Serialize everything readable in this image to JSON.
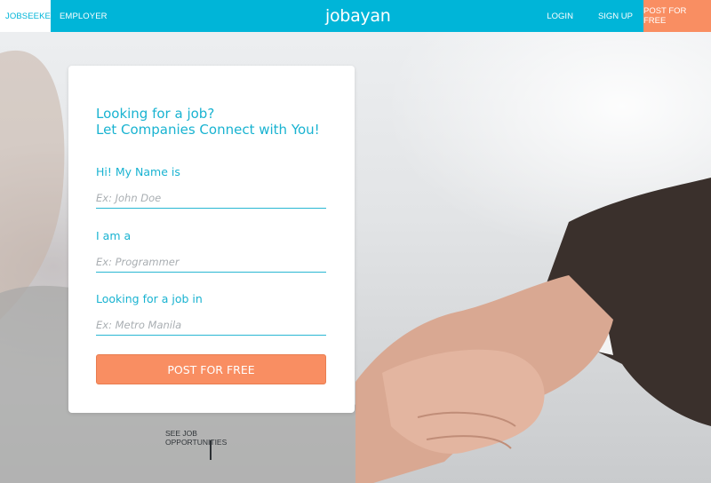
{
  "nav": {
    "jobseeker": "JOBSEEKER",
    "employer": "EMPLOYER",
    "brand": "jobayan",
    "login": "LOGIN",
    "signup": "SIGN UP",
    "post_for_free": "POST FOR FREE"
  },
  "form": {
    "headline_line1": "Looking for a job?",
    "headline_line2": "Let Companies Connect with You!",
    "name_label": "Hi! My Name is",
    "name_placeholder": "Ex: John Doe",
    "role_label": "I am a",
    "role_placeholder": "Ex: Programmer",
    "location_label": "Looking for a job in",
    "location_placeholder": "Ex: Metro Manila",
    "submit_label": "POST FOR FREE"
  },
  "footer": {
    "see_jobs": "SEE JOB OPPORTUNITIES"
  },
  "colors": {
    "primary": "#00b5d8",
    "accent": "#f98e62"
  }
}
